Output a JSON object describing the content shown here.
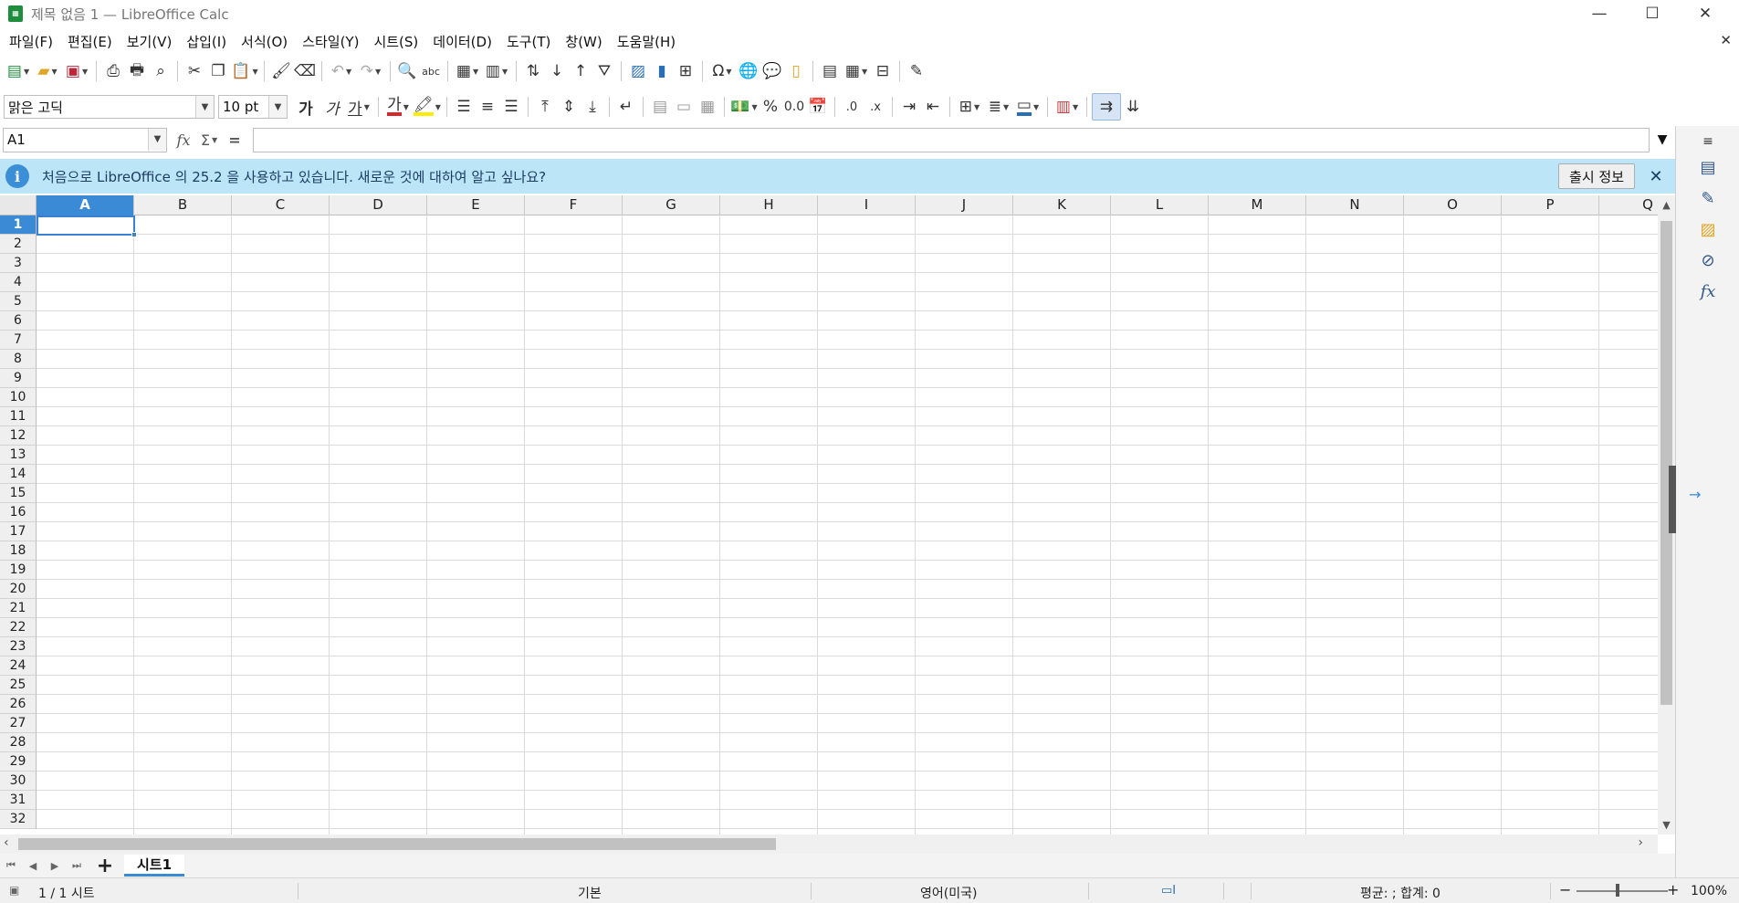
{
  "window": {
    "title": "제목 없음 1 — LibreOffice Calc",
    "app_icon": "calc-icon",
    "controls": [
      "minimize-icon",
      "maximize-icon",
      "close-icon"
    ]
  },
  "menu": {
    "items": [
      "파일(F)",
      "편집(E)",
      "보기(V)",
      "삽입(I)",
      "서식(O)",
      "스타일(Y)",
      "시트(S)",
      "데이터(D)",
      "도구(T)",
      "창(W)",
      "도움말(H)"
    ],
    "close_glyph": "✕"
  },
  "formatting": {
    "font_name": "맑은 고딕",
    "font_size": "10 pt",
    "bold_glyph": "가",
    "italic_glyph": "가",
    "underline_glyph": "가",
    "font_color_glyph": "가"
  },
  "formula_bar": {
    "name_box": "A1",
    "fx": "fx",
    "sum": "Σ",
    "equals": "=",
    "content": ""
  },
  "infobar": {
    "message": "처음으로 LibreOffice 의 25.2 을 사용하고 있습니다. 새로운 것에 대하여 알고 싶나요?",
    "button": "출시 정보",
    "info_glyph": "i",
    "close_glyph": "✕"
  },
  "grid": {
    "columns": [
      "A",
      "B",
      "C",
      "D",
      "E",
      "F",
      "G",
      "H",
      "I",
      "J",
      "K",
      "L",
      "M",
      "N",
      "O",
      "P",
      "Q"
    ],
    "rows": [
      "1",
      "2",
      "3",
      "4",
      "5",
      "6",
      "7",
      "8",
      "9",
      "10",
      "11",
      "12",
      "13",
      "14",
      "15",
      "16",
      "17",
      "18",
      "19",
      "20",
      "21",
      "22",
      "23",
      "24",
      "25",
      "26",
      "27",
      "28",
      "29",
      "30",
      "31",
      "32"
    ],
    "selected_cell": "A1"
  },
  "sheets": {
    "tabs": [
      "시트1"
    ],
    "add_glyph": "+"
  },
  "status": {
    "sheet_info": "1 / 1 시트",
    "page_style": "기본",
    "language": "영어(미국)",
    "summary": "평균: ; 합계: 0",
    "zoom_minus": "−",
    "zoom_plus": "+",
    "zoom": "100%"
  },
  "sidebar": {
    "icons": [
      "menu-icon",
      "properties-icon",
      "styles-icon",
      "gallery-icon",
      "navigator-icon",
      "functions-icon"
    ]
  },
  "colors": {
    "accent": "#3a8ad6",
    "infobar": "#bde5f8",
    "font_color_swatch": "#d62828",
    "highlight_swatch": "#ffee00"
  }
}
